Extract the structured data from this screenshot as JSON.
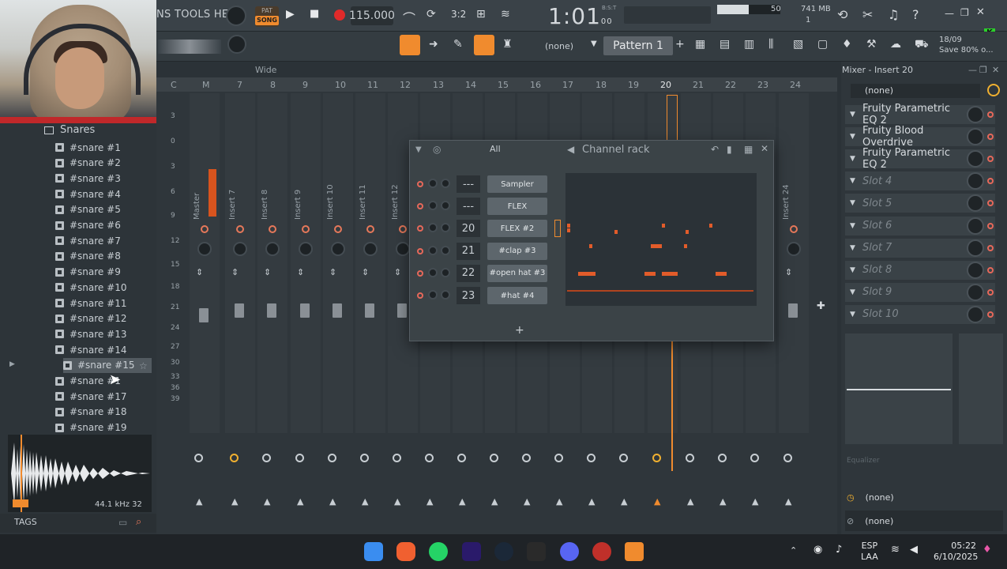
{
  "menu": {
    "text": "NS TOOLS HELP"
  },
  "transport": {
    "mode_pat": "PAT",
    "mode_song": "SONG",
    "tempo": "115.000",
    "time": "1:01",
    "time_sub": "00",
    "time_unit": "B:S:T"
  },
  "meters": {
    "cpu": "50",
    "memory": "741 MB",
    "voices": "1"
  },
  "toolbar2": {
    "snap": "(none)",
    "pattern": "Pattern 1",
    "note_date": "18/09",
    "note_text": "Save 80% o..."
  },
  "browser": {
    "folder": "Snares",
    "items": [
      "#snare #1",
      "#snare #2",
      "#snare #3",
      "#snare #4",
      "#snare #5",
      "#snare #6",
      "#snare #7",
      "#snare #8",
      "#snare #9",
      "#snare #10",
      "#snare #11",
      "#snare #12",
      "#snare #13",
      "#snare #14",
      "#snare #15",
      "#snare #16",
      "#snare #17",
      "#snare #18",
      "#snare #19"
    ],
    "item_16_visible": "#snare #1",
    "sample_info": "44.1 kHz 32",
    "tags_label": "TAGS"
  },
  "mixer": {
    "view_label": "Wide",
    "ruler": [
      "C",
      "M",
      "7",
      "8",
      "9",
      "10",
      "11",
      "12",
      "13",
      "14",
      "15",
      "16",
      "17",
      "18",
      "19",
      "20",
      "21",
      "22",
      "23",
      "24"
    ],
    "db_labels": [
      "3",
      "0",
      "3",
      "6",
      "9",
      "12",
      "15",
      "18",
      "21",
      "24",
      "27",
      "30",
      "33",
      "36",
      "39"
    ],
    "strips": [
      "Master",
      "Insert 7",
      "Insert 8",
      "Insert 9",
      "Insert 10",
      "Insert 11",
      "Insert 12",
      "Insert 24"
    ]
  },
  "channel_rack": {
    "title": "Channel rack",
    "filter": "All",
    "channels": [
      {
        "num": "---",
        "name": "Sampler"
      },
      {
        "num": "---",
        "name": "FLEX"
      },
      {
        "num": "20",
        "name": "FLEX #2"
      },
      {
        "num": "21",
        "name": "#clap #3"
      },
      {
        "num": "22",
        "name": "#open hat #3"
      },
      {
        "num": "23",
        "name": "#hat #4"
      }
    ]
  },
  "insert_panel": {
    "title": "Mixer - Insert 20",
    "preset": "(none)",
    "slots": [
      "Fruity Parametric EQ 2",
      "Fruity Blood Overdrive",
      "Fruity Parametric EQ 2",
      "Slot 4",
      "Slot 5",
      "Slot 6",
      "Slot 7",
      "Slot 8",
      "Slot 9",
      "Slot 10"
    ],
    "eq_label": "Equalizer",
    "route_in": "(none)",
    "route_out": "(none)"
  },
  "taskbar": {
    "lang": "ESP",
    "layout": "LAA",
    "time": "05:22",
    "date": "6/10/2025"
  },
  "colors": {
    "accent": "#f08b2e",
    "note": "#e25c2a",
    "led": "#e6685a"
  }
}
